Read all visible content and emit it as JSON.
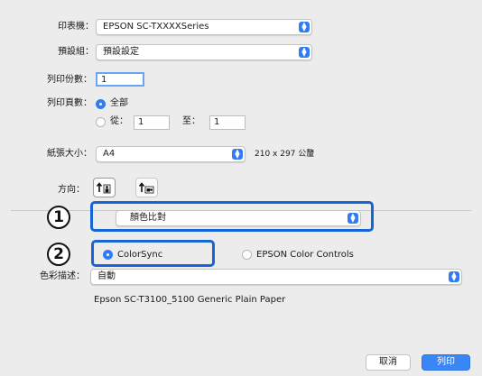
{
  "printer": {
    "label": "印表機：",
    "value": "EPSON SC-TXXXXSeries"
  },
  "presets": {
    "label": "預設組：",
    "value": "預設設定"
  },
  "copies": {
    "label": "列印份數：",
    "value": "1"
  },
  "pages": {
    "label": "列印頁數：",
    "all_label": "全部",
    "from_label": "從：",
    "from_value": "1",
    "to_label": "至：",
    "to_value": "1"
  },
  "paper_size": {
    "label": "紙張大小：",
    "value": "A4",
    "dimensions": "210 x 297 公釐"
  },
  "orientation": {
    "label": "方向："
  },
  "panel": {
    "value": "顏色比對"
  },
  "color_matching": {
    "option_colorsync": "ColorSync",
    "option_epson": "EPSON Color Controls"
  },
  "profile": {
    "label": "色彩描述：",
    "value": "自動",
    "description": "Epson SC-T3100_5100 Generic Plain Paper"
  },
  "callouts": {
    "one": "1",
    "two": "2"
  },
  "buttons": {
    "cancel": "取消",
    "print": "列印"
  },
  "colors": {
    "accent": "#2f7cf6",
    "callout": "#1565d8"
  },
  "icons": [
    "chevron-updown-icon",
    "portrait-icon",
    "landscape-icon"
  ]
}
